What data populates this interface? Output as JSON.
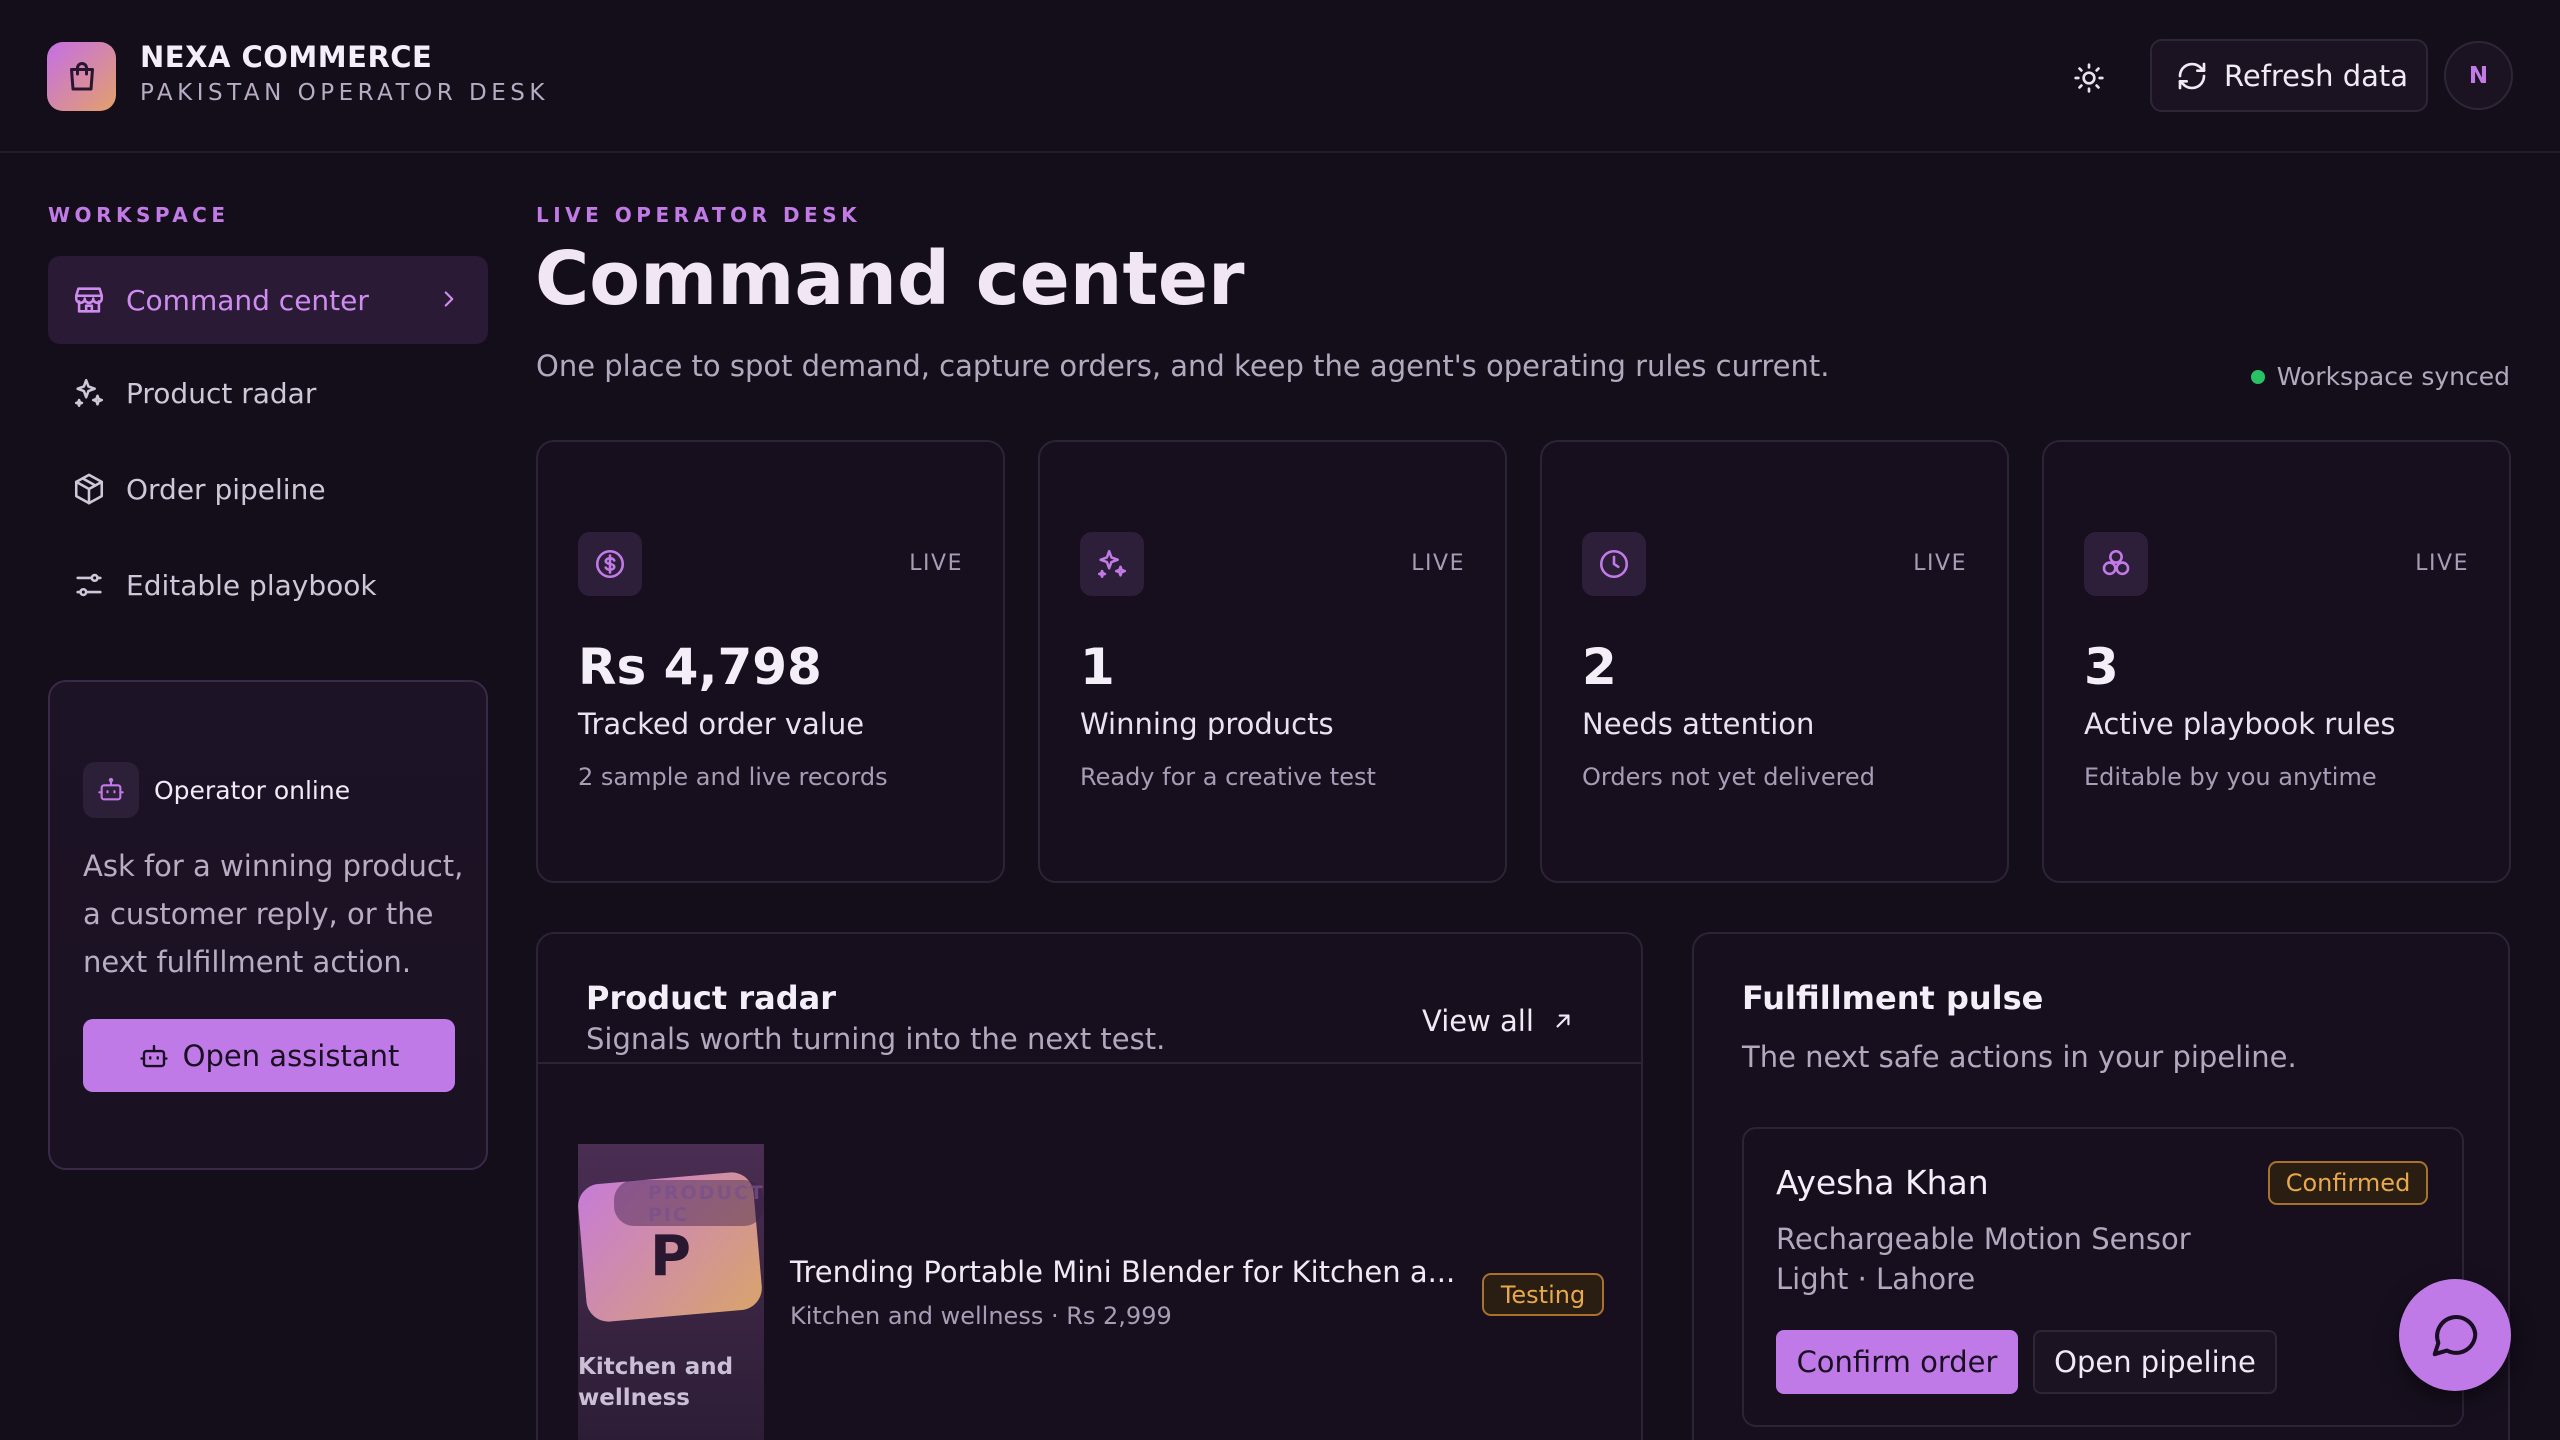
{
  "brand": {
    "name": "NEXA COMMERCE",
    "subtitle": "PAKISTAN OPERATOR DESK"
  },
  "topbar": {
    "refresh_label": "Refresh data",
    "avatar_initial": "N"
  },
  "sidebar": {
    "section_label": "WORKSPACE",
    "items": [
      {
        "label": "Command center",
        "icon": "store-icon",
        "active": true
      },
      {
        "label": "Product radar",
        "icon": "sparkles-icon",
        "active": false
      },
      {
        "label": "Order pipeline",
        "icon": "package-icon",
        "active": false
      },
      {
        "label": "Editable playbook",
        "icon": "sliders-icon",
        "active": false
      }
    ],
    "operator": {
      "title": "Operator online",
      "description": "Ask for a winning product, a customer reply, or the next fulfillment action.",
      "button_label": "Open assistant"
    }
  },
  "header": {
    "eyebrow": "LIVE OPERATOR DESK",
    "title": "Command center",
    "description": "One place to spot demand, capture orders, and keep the agent's operating rules current.",
    "sync_status": "Workspace synced"
  },
  "stats": [
    {
      "icon": "dollar-icon",
      "badge": "LIVE",
      "value": "Rs 4,798",
      "label": "Tracked order value",
      "sub": "2 sample and live records"
    },
    {
      "icon": "sparkles-icon",
      "badge": "LIVE",
      "value": "1",
      "label": "Winning products",
      "sub": "Ready for a creative test"
    },
    {
      "icon": "clock-icon",
      "badge": "LIVE",
      "value": "2",
      "label": "Needs attention",
      "sub": "Orders not yet delivered"
    },
    {
      "icon": "workflow-icon",
      "badge": "LIVE",
      "value": "3",
      "label": "Active playbook rules",
      "sub": "Editable by you anytime"
    }
  ],
  "product_radar": {
    "title": "Product radar",
    "subtitle": "Signals worth turning into the next test.",
    "view_all": "View all",
    "products": [
      {
        "thumb_caption": "PRODUCT PIC",
        "thumb_letter": "P",
        "thumb_label": "Kitchen and wellness",
        "name": "Trending Portable Mini Blender for Kitchen a...",
        "meta": "Kitchen and wellness · Rs 2,999",
        "status": "Testing"
      }
    ]
  },
  "fulfillment": {
    "title": "Fulfillment pulse",
    "subtitle": "The next safe actions in your pipeline.",
    "orders": [
      {
        "customer": "Ayesha Khan",
        "status": "Confirmed",
        "description": "Rechargeable Motion Sensor Light · Lahore",
        "primary_action": "Confirm order",
        "secondary_action": "Open pipeline"
      }
    ]
  },
  "colors": {
    "background": "#140d1a",
    "accent": "#c07ae8",
    "warning": "#e7a94b",
    "success": "#28c264"
  }
}
